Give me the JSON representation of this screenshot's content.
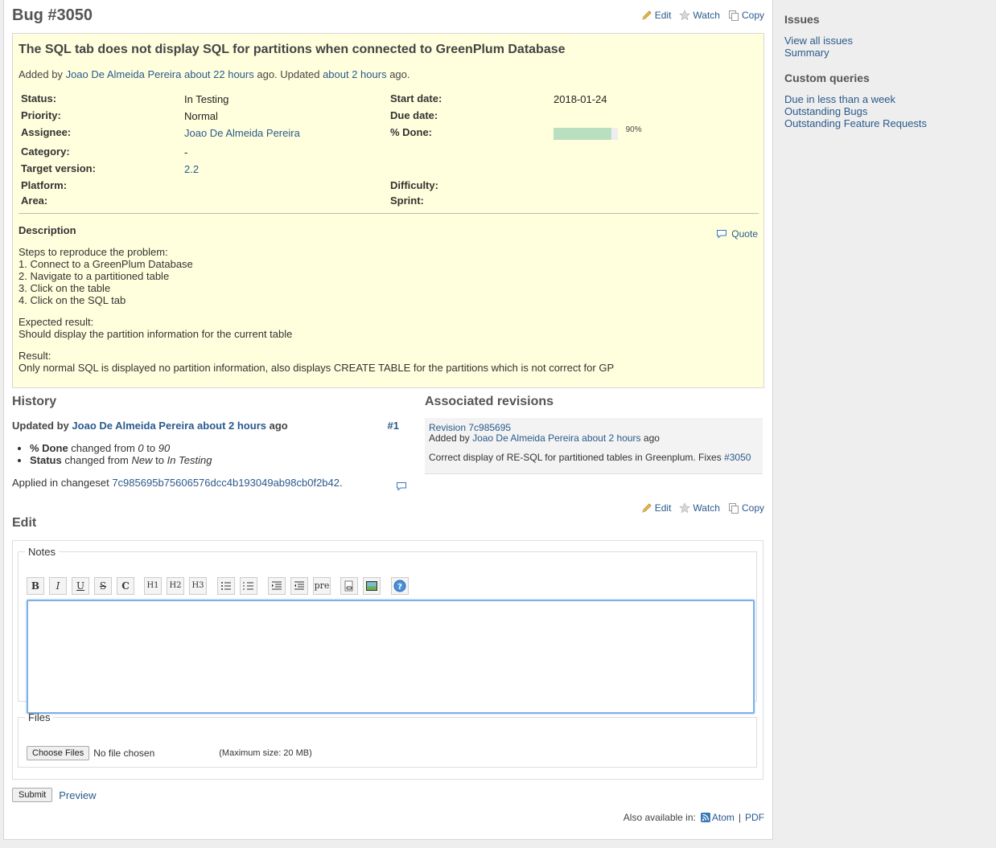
{
  "issue": {
    "heading": "Bug #3050",
    "subject": "The SQL tab does not display SQL for partitions when connected to GreenPlum Database",
    "author_prefix": "Added by",
    "author_name": "Joao De Almeida Pereira",
    "added_ago": "about 22 hours",
    "updated_mid": "ago. Updated",
    "updated_ago": "about 2 hours",
    "updated_suffix": "ago.",
    "actions": {
      "edit": "Edit",
      "watch": "Watch",
      "copy": "Copy"
    },
    "attributes": {
      "status_label": "Status:",
      "status_value": "In Testing",
      "priority_label": "Priority:",
      "priority_value": "Normal",
      "assignee_label": "Assignee:",
      "assignee_value": "Joao De Almeida Pereira",
      "category_label": "Category:",
      "category_value": "-",
      "target_label": "Target version:",
      "target_value": "2.2",
      "platform_label": "Platform:",
      "area_label": "Area:",
      "start_label": "Start date:",
      "start_value": "2018-01-24",
      "due_label": "Due date:",
      "done_label": "% Done:",
      "done_value": 0.9,
      "done_text": "90%",
      "difficulty_label": "Difficulty:",
      "sprint_label": "Sprint:"
    },
    "description": {
      "heading": "Description",
      "quote": "Quote",
      "steps_title": "Steps to reproduce the problem:",
      "step1": "1. Connect to a GreenPlum Database",
      "step2": "2. Navigate to a partitioned table",
      "step3": "3. Click on the table",
      "step4": "4. Click on the SQL tab",
      "expected_title": "Expected result:",
      "expected": "Should display the partition information for the current table",
      "result_title": "Result:",
      "result": "Only normal SQL is displayed no partition information, also displays CREATE TABLE for the partitions which is not correct for GP"
    }
  },
  "history": {
    "heading": "History",
    "updated_by": "Updated by",
    "user": "Joao De Almeida Pereira",
    "ago": "about 2 hours",
    "ago_suffix": "ago",
    "note_id": "#1",
    "change1_field": "% Done",
    "change1_mid": "changed from",
    "change1_from": "0",
    "change1_to_word": "to",
    "change1_to": "90",
    "change2_field": "Status",
    "change2_mid": "changed from",
    "change2_from": "New",
    "change2_to_word": "to",
    "change2_to": "In Testing",
    "applied_prefix": "Applied in changeset",
    "changeset": "7c985695b75606576dcc4b193049ab98cb0f2b42",
    "applied_suffix": "."
  },
  "revisions": {
    "heading": "Associated revisions",
    "revision": "Revision 7c985695",
    "added_by": "Added by",
    "user": "Joao De Almeida Pereira",
    "ago": "about 2 hours",
    "ago_suffix": "ago",
    "message": "Correct display of RE-SQL for partitioned tables in Greenplum. Fixes",
    "fix_ref": "#3050"
  },
  "edit": {
    "heading": "Edit",
    "notes_legend": "Notes",
    "toolbar": {
      "bold": "B",
      "italic": "I",
      "underline": "U",
      "strike": "S",
      "code": "C",
      "h1": "H1",
      "h2": "H2",
      "h3": "H3",
      "pre": "pre"
    },
    "files_legend": "Files",
    "choose_files": "Choose Files",
    "no_file": "No file chosen",
    "max_size": "(Maximum size: 20 MB)",
    "submit": "Submit",
    "preview": "Preview"
  },
  "other_formats": {
    "label": "Also available in:",
    "atom": "Atom",
    "separator": "|",
    "pdf": "PDF"
  },
  "sidebar": {
    "issues_heading": "Issues",
    "view_all": "View all issues",
    "summary": "Summary",
    "custom_heading": "Custom queries",
    "q1": "Due in less than a week",
    "q2": "Outstanding Bugs",
    "q3": "Outstanding Feature Requests"
  },
  "colors": {
    "link": "#2a5a8c",
    "issue_bg": "#ffffdd",
    "progress": "#b8e0c0"
  }
}
